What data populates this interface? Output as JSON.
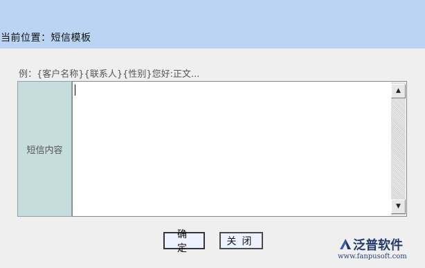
{
  "header": {
    "breadcrumb": "当前位置：短信模板"
  },
  "form": {
    "hint": "例：{客户名称}{联系人}{性别}您好:正文...",
    "content_label": "短信内容",
    "content_value": ""
  },
  "buttons": {
    "confirm": "确定",
    "close": "关闭"
  },
  "branding": {
    "name": "泛普软件",
    "url": "www.fanpusoft.com"
  },
  "colors": {
    "header_bg": "#bcd4f4",
    "label_bg": "#c7dcdc",
    "page_bg": "#efefef"
  }
}
